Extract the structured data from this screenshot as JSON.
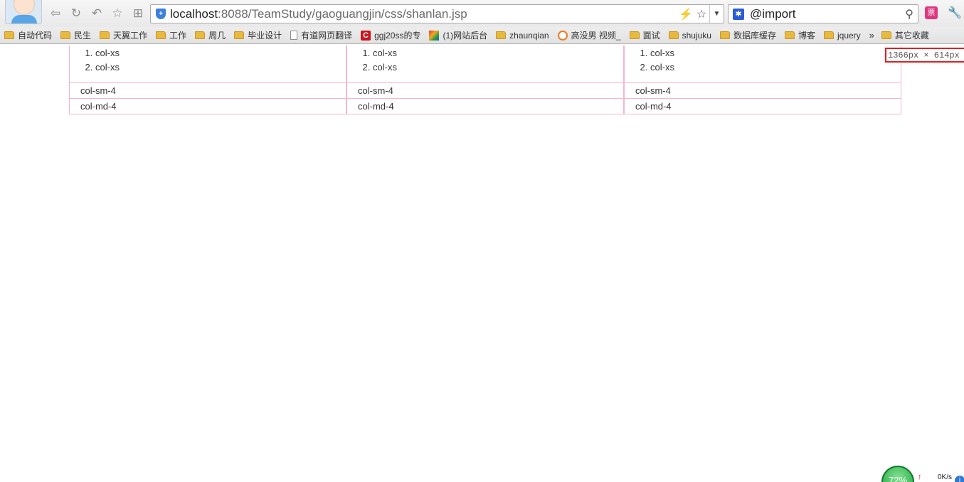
{
  "browser": {
    "url_host": "localhost",
    "url_path": ":8088/TeamStudy/gaoguangjin/css/shanlan.jsp",
    "search_value": "@import",
    "ext_label": "票"
  },
  "bookmarks": [
    {
      "label": "自动代码",
      "icon": "folder-icon"
    },
    {
      "label": "民生",
      "icon": "folder-icon"
    },
    {
      "label": "天翼工作",
      "icon": "folder-icon"
    },
    {
      "label": "工作",
      "icon": "folder-icon"
    },
    {
      "label": "周几",
      "icon": "folder-icon"
    },
    {
      "label": "毕业设计",
      "icon": "folder-icon"
    },
    {
      "label": "有道网页翻译",
      "icon": "page-icon"
    },
    {
      "label": "ggj20ss的专",
      "icon": "csdn-icon"
    },
    {
      "label": "(1)网站后台",
      "icon": "site-icon"
    },
    {
      "label": "zhaunqian",
      "icon": "folder-icon"
    },
    {
      "label": "高没男 视频_",
      "icon": "circle-icon"
    },
    {
      "label": "面试",
      "icon": "folder-icon"
    },
    {
      "label": "shujuku",
      "icon": "folder-icon"
    },
    {
      "label": "数据库缓存",
      "icon": "folder-icon"
    },
    {
      "label": "博客",
      "icon": "folder-icon"
    },
    {
      "label": "jquery",
      "icon": "folder-icon"
    }
  ],
  "bookmarks_more": "»",
  "other_bookmarks": "其它收藏",
  "grid": {
    "xs_items": [
      "col-xs",
      "col-xs"
    ],
    "sm_cells": [
      "col-sm-4",
      "col-sm-4",
      "col-sm-4"
    ],
    "md_cells": [
      "col-md-4",
      "col-md-4",
      "col-md-4"
    ]
  },
  "resolution_badge": "1366px × 614px",
  "status_widget": {
    "percent": "72%",
    "speed": "0K/s"
  }
}
